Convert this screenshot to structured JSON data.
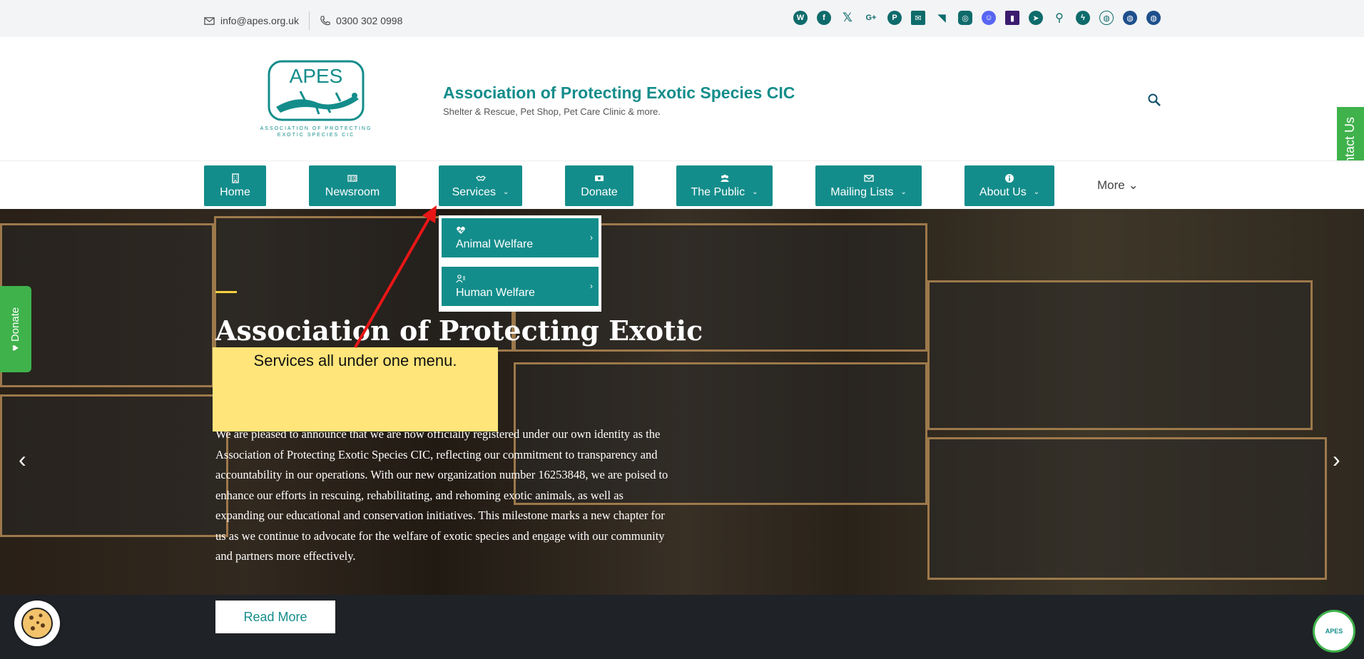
{
  "topbar": {
    "email": "info@apes.org.uk",
    "phone": "0300 302 0998",
    "social_icons": [
      "whatsapp-icon",
      "facebook-icon",
      "x-icon",
      "google-plus-icon",
      "pinterest-icon",
      "mail-icon",
      "rss-icon",
      "instagram-icon",
      "discord-icon",
      "twitch-icon",
      "telegram-icon",
      "location-icon",
      "messenger-icon",
      "globe-icon",
      "globe-icon",
      "globe-icon"
    ]
  },
  "header": {
    "logo_text": "APES",
    "logo_subtext": "ASSOCIATION OF PROTECTING EXOTIC SPECIES CIC",
    "title": "Association of Protecting Exotic Species CIC",
    "tagline": "Shelter & Rescue, Pet Shop, Pet Care Clinic & more.",
    "contact_tab": "Contact Us"
  },
  "nav": {
    "items": [
      {
        "label": "Home",
        "icon": "building-icon"
      },
      {
        "label": "Newsroom",
        "icon": "newspaper-icon"
      },
      {
        "label": "Services",
        "icon": "handshake-icon",
        "chevron": "⌄"
      },
      {
        "label": "Donate",
        "icon": "money-icon"
      },
      {
        "label": "The Public",
        "icon": "users-icon",
        "chevron": "⌄"
      },
      {
        "label": "Mailing Lists",
        "icon": "envelope-icon",
        "chevron": "⌄"
      },
      {
        "label": "About Us",
        "icon": "info-icon",
        "chevron": "⌄"
      }
    ],
    "more": "More ⌄"
  },
  "dropdown": {
    "items": [
      {
        "label": "Animal Welfare",
        "icon": "heart-pulse-icon"
      },
      {
        "label": "Human Welfare",
        "icon": "person-icon"
      }
    ]
  },
  "hero": {
    "title": "Association of Protecting Exotic",
    "body": "We are pleased to announce that we are now officially registered under our own identity as the Association of Protecting Exotic Species CIC, reflecting our commitment to transparency and accountability in our operations. With our new organization number 16253848, we are poised to enhance our efforts in rescuing, rehabilitating, and rehoming exotic animals, as well as expanding our educational and conservation initiatives. This milestone marks a new chapter for us as we continue to advocate for the welfare of exotic species and engage with our community and partners more effectively.",
    "read_more": "Read More",
    "prev": "‹",
    "next": "›"
  },
  "side": {
    "donate": "Donate"
  },
  "annotation": {
    "text": "Services all under one menu."
  },
  "colors": {
    "brand_teal": "#138d8b",
    "green": "#3fb24b",
    "note_yellow": "#ffe57a",
    "arrow_red": "#e81616"
  }
}
